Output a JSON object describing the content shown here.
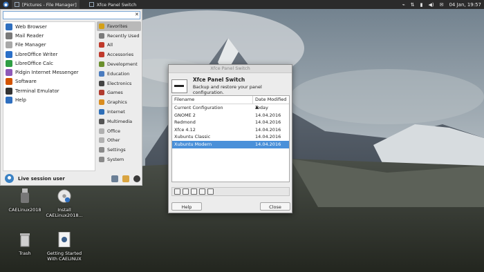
{
  "top_panel": {
    "tasks": [
      {
        "label": "[Pictures - File Manager]"
      },
      {
        "label": "Xfce Panel Switch"
      }
    ],
    "clock": "04 Jan, 19:57"
  },
  "menu": {
    "search": {
      "value": "",
      "placeholder": ""
    },
    "favorites": [
      {
        "label": "Web Browser",
        "color": "#2f6fbf"
      },
      {
        "label": "Mail Reader",
        "color": "#7a7a7a"
      },
      {
        "label": "File Manager",
        "color": "#a8a8a8"
      },
      {
        "label": "LibreOffice Writer",
        "color": "#2a6fc8"
      },
      {
        "label": "LibreOffice Calc",
        "color": "#2f9e44"
      },
      {
        "label": "Pidgin Internet Messenger",
        "color": "#8e5ab8"
      },
      {
        "label": "Software",
        "color": "#d35400"
      },
      {
        "label": "Terminal Emulator",
        "color": "#333333"
      },
      {
        "label": "Help",
        "color": "#2f6fbf"
      }
    ],
    "categories": [
      {
        "label": "Favorites",
        "color": "#d4a017",
        "selected": true
      },
      {
        "label": "Recently Used",
        "color": "#7a7a7a",
        "selected": false
      },
      {
        "label": "All",
        "color": "#c0392b",
        "selected": false
      },
      {
        "label": "Accessories",
        "color": "#c0392b",
        "selected": false
      },
      {
        "label": "Development",
        "color": "#6a8f2c",
        "selected": false
      },
      {
        "label": "Education",
        "color": "#4a7bbf",
        "selected": false
      },
      {
        "label": "Electronics",
        "color": "#444444",
        "selected": false
      },
      {
        "label": "Games",
        "color": "#b03a2e",
        "selected": false
      },
      {
        "label": "Graphics",
        "color": "#d98c1f",
        "selected": false
      },
      {
        "label": "Internet",
        "color": "#2e6fb8",
        "selected": false
      },
      {
        "label": "Multimedia",
        "color": "#555555",
        "selected": false
      },
      {
        "label": "Office",
        "color": "#b0b0b0",
        "selected": false
      },
      {
        "label": "Other",
        "color": "#b0b0b0",
        "selected": false
      },
      {
        "label": "Settings",
        "color": "#8a8a8a",
        "selected": false
      },
      {
        "label": "System",
        "color": "#8a8a8a",
        "selected": false
      }
    ],
    "user": "Live session user"
  },
  "desktop": {
    "icons": [
      {
        "label": "CAELinux2018"
      },
      {
        "label": "Install CAELinux2018..."
      },
      {
        "label": "Trash"
      },
      {
        "label": "Getting Started With CAELINUX"
      }
    ]
  },
  "dialog": {
    "window_title": "Xfce Panel Switch",
    "heading": "Xfce Panel Switch",
    "subheading": "Backup and restore your panel configuration.",
    "columns": {
      "filename": "Filename",
      "date": "Date Modified"
    },
    "rows": [
      {
        "filename": "Current Configuration",
        "date": "Today",
        "selected": false
      },
      {
        "filename": "GNOME 2",
        "date": "14.04.2016",
        "selected": false
      },
      {
        "filename": "Redmond",
        "date": "14.04.2016",
        "selected": false
      },
      {
        "filename": "Xfce 4.12",
        "date": "14.04.2016",
        "selected": false
      },
      {
        "filename": "Xubuntu Classic",
        "date": "14.04.2016",
        "selected": false
      },
      {
        "filename": "Xubuntu Modern",
        "date": "14.04.2016",
        "selected": true
      }
    ],
    "help_label": "Help",
    "close_label": "Close"
  }
}
